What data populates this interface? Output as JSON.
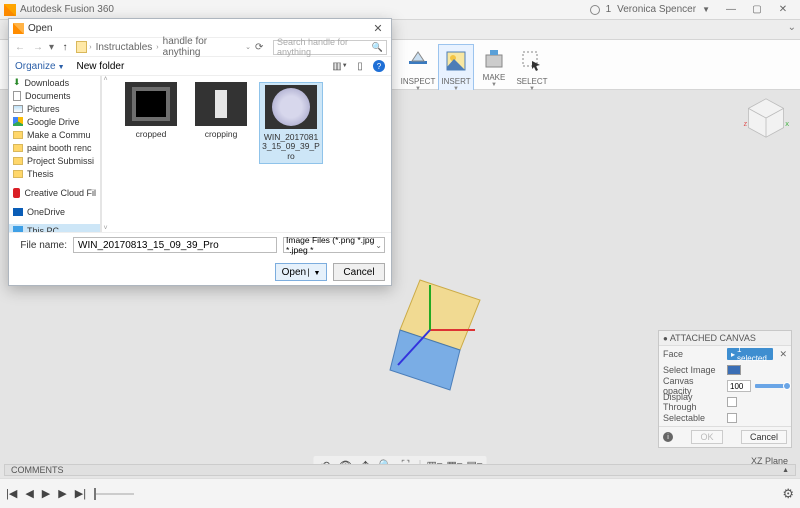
{
  "app": {
    "title": "Autodesk Fusion 360",
    "undo_badge": "1",
    "user_name": "Veronica Spencer"
  },
  "window_buttons": {
    "minimize": "—",
    "maximize": "▢",
    "close": "✕"
  },
  "ribbon": {
    "tools": [
      {
        "name": "inspect",
        "label": "INSPECT",
        "dropdown": true
      },
      {
        "name": "insert",
        "label": "INSERT",
        "dropdown": true,
        "selected": true
      },
      {
        "name": "make",
        "label": "MAKE",
        "dropdown": true
      },
      {
        "name": "select",
        "label": "SELECT",
        "dropdown": true
      }
    ]
  },
  "openDialog": {
    "title": "Open",
    "breadcrumbs": [
      "Instructables",
      "handle for anything"
    ],
    "search_placeholder": "Search handle for anything",
    "organize": "Organize",
    "new_folder": "New folder",
    "sidebar": [
      {
        "icon": "download",
        "label": "Downloads"
      },
      {
        "icon": "doc",
        "label": "Documents"
      },
      {
        "icon": "pic",
        "label": "Pictures"
      },
      {
        "icon": "gdrive",
        "label": "Google Drive"
      },
      {
        "icon": "folder",
        "label": "Make a Commu"
      },
      {
        "icon": "folder",
        "label": "paint booth renc"
      },
      {
        "icon": "folder",
        "label": "Project Submissi"
      },
      {
        "icon": "folder",
        "label": "Thesis"
      },
      {
        "icon": "cc",
        "label": "Creative Cloud Fil",
        "group_break_before": true
      },
      {
        "icon": "onedrive",
        "label": "OneDrive",
        "group_break_before": true
      },
      {
        "icon": "thispc",
        "label": "This PC",
        "selected": true,
        "group_break_before": true
      }
    ],
    "files": [
      {
        "name": "cropped",
        "thumb": "cropped"
      },
      {
        "name": "cropping",
        "thumb": "cropping"
      },
      {
        "name": "WIN_20170813_15_09_39_Pro",
        "thumb": "win",
        "selected": true
      }
    ],
    "filename_label": "File name:",
    "filename_value": "WIN_20170813_15_09_39_Pro",
    "filetype": "Image Files (*.png *.jpg *.jpeg *",
    "open_btn": "Open",
    "cancel_btn": "Cancel"
  },
  "attachedCanvas": {
    "title": "ATTACHED CANVAS",
    "rows": {
      "face": {
        "label": "Face",
        "pill": "1 selected"
      },
      "select_image": {
        "label": "Select Image"
      },
      "canvas_opacity": {
        "label": "Canvas opacity",
        "value": "100"
      },
      "display_through": {
        "label": "Display Through",
        "checked": false
      },
      "selectable": {
        "label": "Selectable",
        "checked": false
      }
    },
    "ok": "OK",
    "cancel": "Cancel"
  },
  "comments": {
    "label": "COMMENTS"
  },
  "status": {
    "plane": "XZ Plane"
  }
}
